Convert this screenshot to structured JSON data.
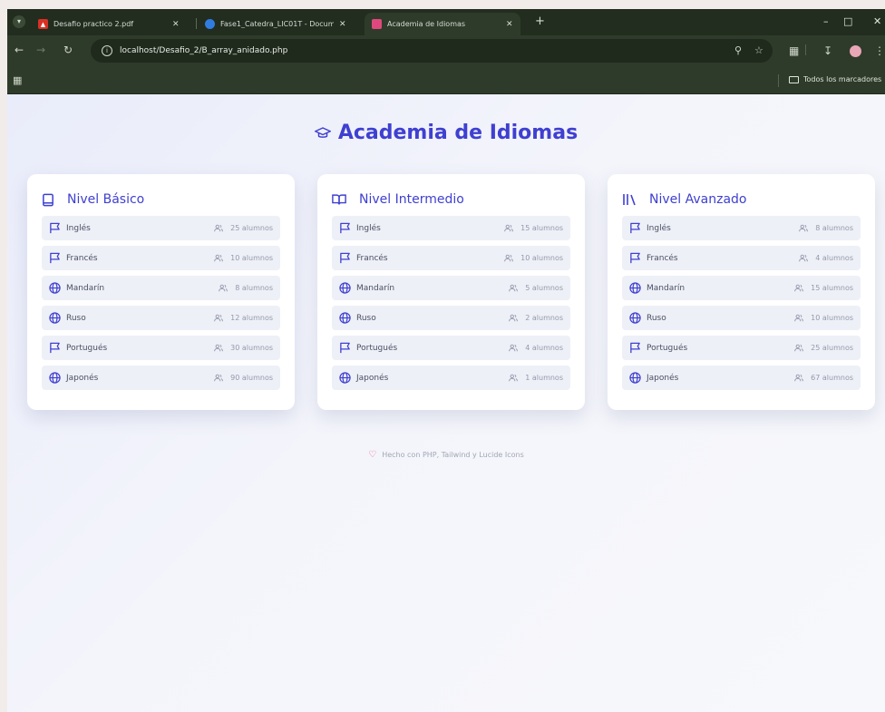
{
  "browser": {
    "tabs": [
      {
        "title": "Desafio practico 2.pdf",
        "icon": "pdf-icon",
        "active": false
      },
      {
        "title": "Fase1_Catedra_LIC01T - Docum",
        "icon": "edge-doc-icon",
        "active": false
      },
      {
        "title": "Academia de Idiomas",
        "icon": "site-icon",
        "active": true
      }
    ],
    "url": "localhost/Desafio_2/B_array_anidado.php",
    "bookmarks_folder": "Todos los marcadores"
  },
  "page": {
    "title": "Academia de Idiomas",
    "accent_color": "#3f40d0",
    "levels": [
      {
        "name": "Nivel Básico",
        "icon": "book-icon",
        "languages": [
          {
            "name": "Inglés",
            "icon": "flag-icon",
            "count": "25 alumnos"
          },
          {
            "name": "Francés",
            "icon": "flag-icon",
            "count": "10 alumnos"
          },
          {
            "name": "Mandarín",
            "icon": "globe-icon",
            "count": "8 alumnos"
          },
          {
            "name": "Ruso",
            "icon": "globe-icon",
            "count": "12 alumnos"
          },
          {
            "name": "Portugués",
            "icon": "flag-icon",
            "count": "30 alumnos"
          },
          {
            "name": "Japonés",
            "icon": "globe-icon",
            "count": "90 alumnos"
          }
        ]
      },
      {
        "name": "Nivel Intermedio",
        "icon": "book-open-icon",
        "languages": [
          {
            "name": "Inglés",
            "icon": "flag-icon",
            "count": "15 alumnos"
          },
          {
            "name": "Francés",
            "icon": "flag-icon",
            "count": "10 alumnos"
          },
          {
            "name": "Mandarín",
            "icon": "globe-icon",
            "count": "5 alumnos"
          },
          {
            "name": "Ruso",
            "icon": "globe-icon",
            "count": "2 alumnos"
          },
          {
            "name": "Portugués",
            "icon": "flag-icon",
            "count": "4 alumnos"
          },
          {
            "name": "Japonés",
            "icon": "globe-icon",
            "count": "1 alumnos"
          }
        ]
      },
      {
        "name": "Nivel Avanzado",
        "icon": "library-icon",
        "languages": [
          {
            "name": "Inglés",
            "icon": "flag-icon",
            "count": "8 alumnos"
          },
          {
            "name": "Francés",
            "icon": "flag-icon",
            "count": "4 alumnos"
          },
          {
            "name": "Mandarín",
            "icon": "globe-icon",
            "count": "15 alumnos"
          },
          {
            "name": "Ruso",
            "icon": "globe-icon",
            "count": "10 alumnos"
          },
          {
            "name": "Portugués",
            "icon": "flag-icon",
            "count": "25 alumnos"
          },
          {
            "name": "Japonés",
            "icon": "globe-icon",
            "count": "67 alumnos"
          }
        ]
      }
    ],
    "footer": "Hecho con PHP, Tailwind y Lucide Icons"
  }
}
